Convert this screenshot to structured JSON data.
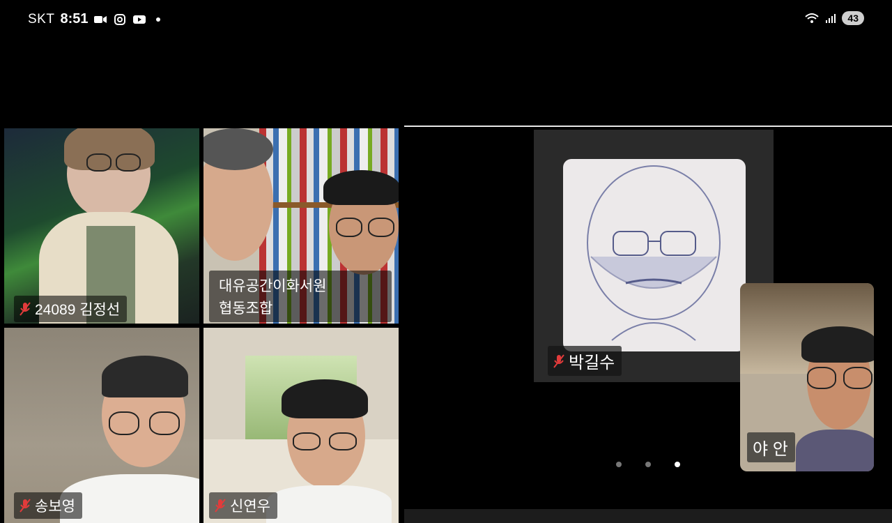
{
  "status_bar": {
    "carrier": "SKT",
    "time": "8:51",
    "battery": "43"
  },
  "participants": [
    {
      "name": "24089 김정선",
      "muted": true
    },
    {
      "name_line1": "대유공간이화서원",
      "name_line2": "협동조합"
    },
    {
      "name": "송보영",
      "muted": true
    },
    {
      "name": "신연우",
      "muted": true
    }
  ],
  "active_speaker": {
    "name": "박길수",
    "muted": true
  },
  "self_view": {
    "name": "야 안"
  },
  "pagination": {
    "pages": 3,
    "current": 3
  },
  "colors": {
    "background": "#000000",
    "muted_icon": "#e23b3b"
  }
}
